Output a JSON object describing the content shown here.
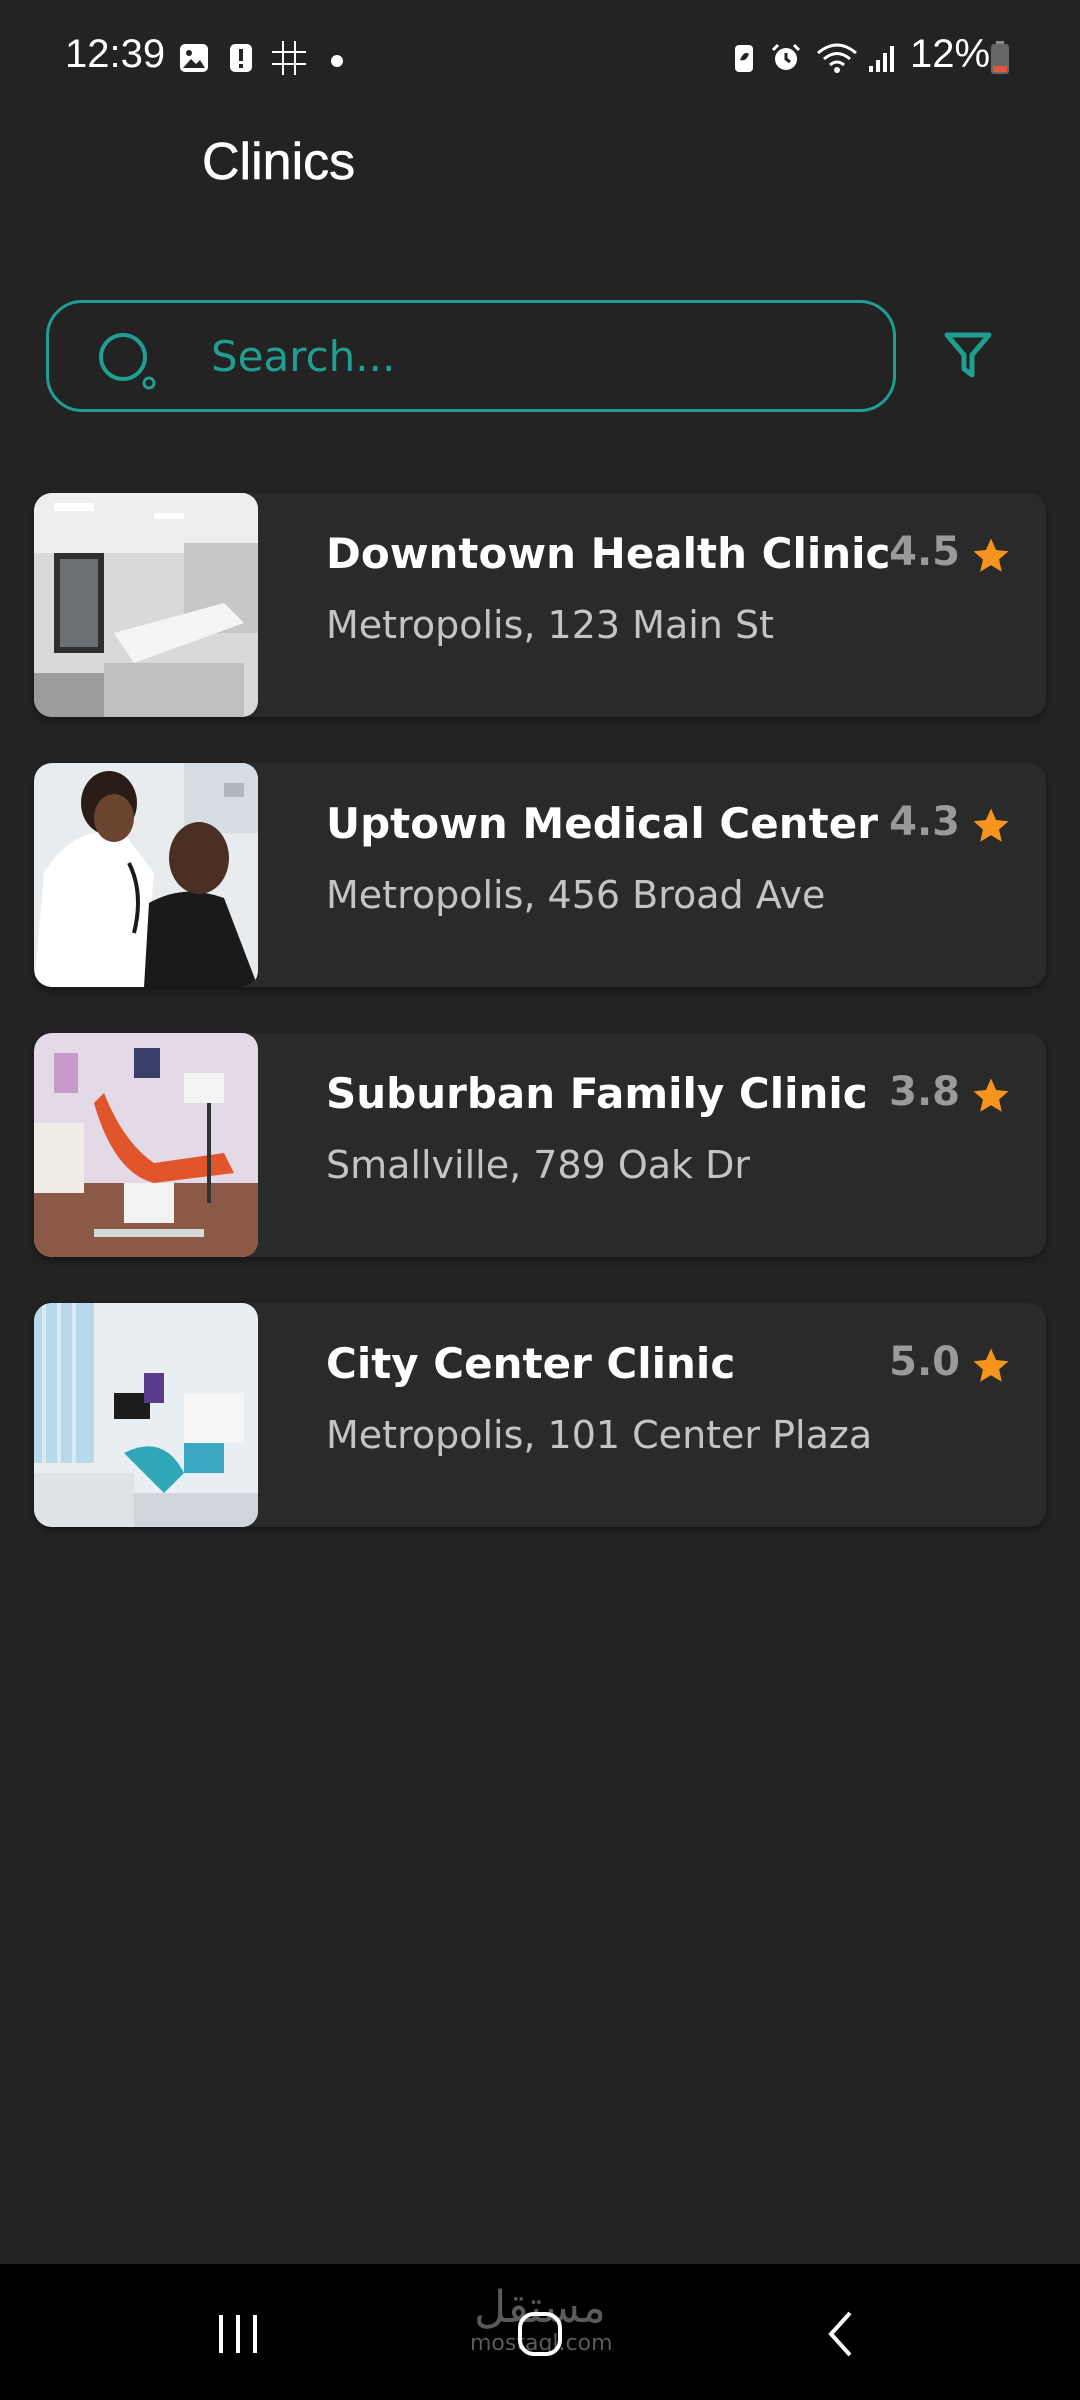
{
  "status_bar": {
    "time": "12:39",
    "battery": "12%",
    "left_icons": [
      "image-icon",
      "alert-icon",
      "tictactoe-icon"
    ],
    "right_icons": [
      "battery-saver-icon",
      "alarm-icon",
      "wifi-icon",
      "signal-icon",
      "battery-icon"
    ]
  },
  "header": {
    "title": "Clinics"
  },
  "search": {
    "placeholder": "Search...",
    "icon": "search-icon"
  },
  "filter": {
    "icon": "filter-icon"
  },
  "colors": {
    "background": "#232323",
    "card": "#2a2a2a",
    "accent": "#1f9e91",
    "star": "#f7941d",
    "rating_text": "#9a9a9a"
  },
  "clinics": [
    {
      "name": "Downtown Health Clinic",
      "address": "Metropolis, 123 Main St",
      "rating": "4.5",
      "image": "white-clinic-room-photo"
    },
    {
      "name": "Uptown Medical Center",
      "address": "Metropolis, 456 Broad Ave",
      "rating": "4.3",
      "image": "doctor-examining-patient-photo"
    },
    {
      "name": "Suburban Family Clinic",
      "address": "Smallville, 789 Oak Dr",
      "rating": "3.8",
      "image": "dental-chair-photo"
    },
    {
      "name": "City Center Clinic",
      "address": "Metropolis, 101 Center Plaza",
      "rating": "5.0",
      "image": "dental-office-photo"
    }
  ],
  "nav_bar": {
    "buttons": [
      "recents-button",
      "home-button",
      "back-button"
    ],
    "watermark_ar": "مستقل",
    "watermark_en": "mostaql.com"
  }
}
